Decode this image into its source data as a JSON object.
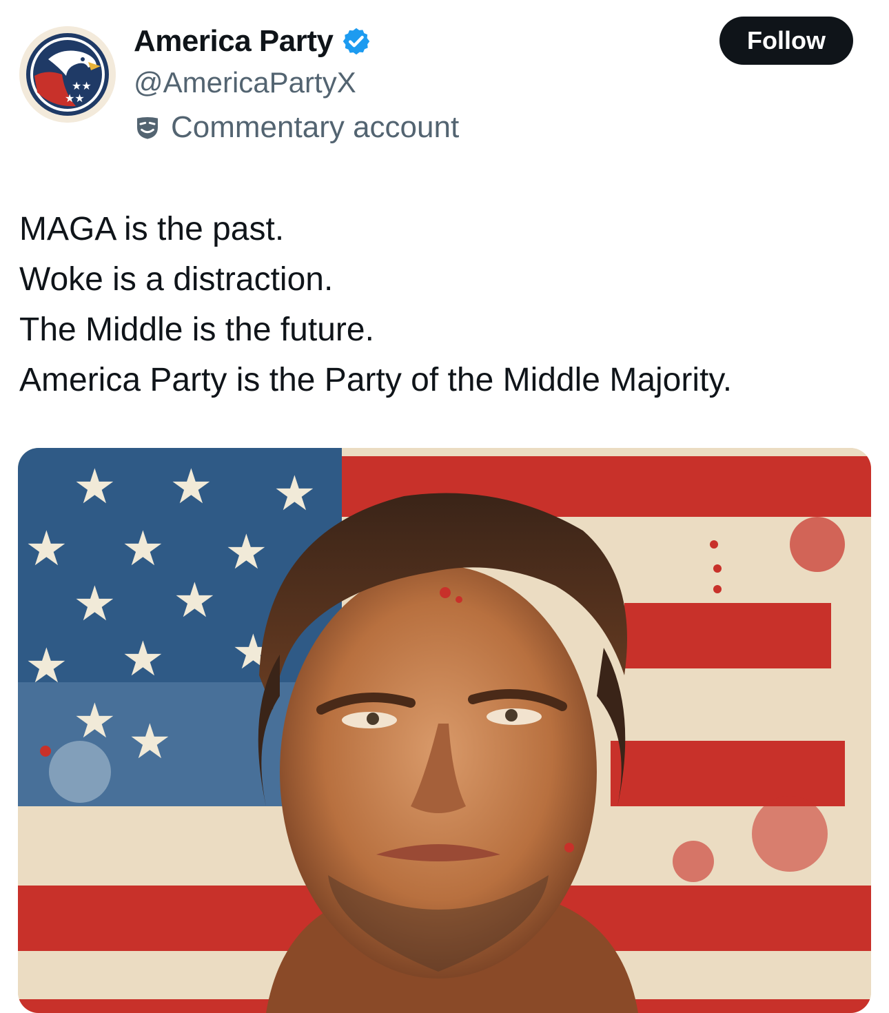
{
  "tweet": {
    "author": {
      "display_name": "America Party",
      "handle": "@AmericaPartyX",
      "verified": true,
      "account_label": "Commentary account",
      "avatar_icon": "eagle-logo-icon",
      "label_icon": "mask-icon",
      "verified_icon": "verified-badge-icon"
    },
    "follow_label": "Follow",
    "text_lines": [
      "MAGA is the past.",
      "Woke is a distraction.",
      "The Middle is the future.",
      "America Party is the Party of the Middle Majority."
    ],
    "media": {
      "type": "image",
      "description_icon": "portrait-flag-painting"
    }
  },
  "colors": {
    "text_primary": "#0f1419",
    "text_secondary": "#536471",
    "verified_blue": "#1d9bf0",
    "follow_bg": "#0f1419",
    "follow_text": "#ffffff",
    "flag_red": "#c8312a",
    "flag_blue": "#2f5a86",
    "avatar_navy": "#1f3a66"
  }
}
